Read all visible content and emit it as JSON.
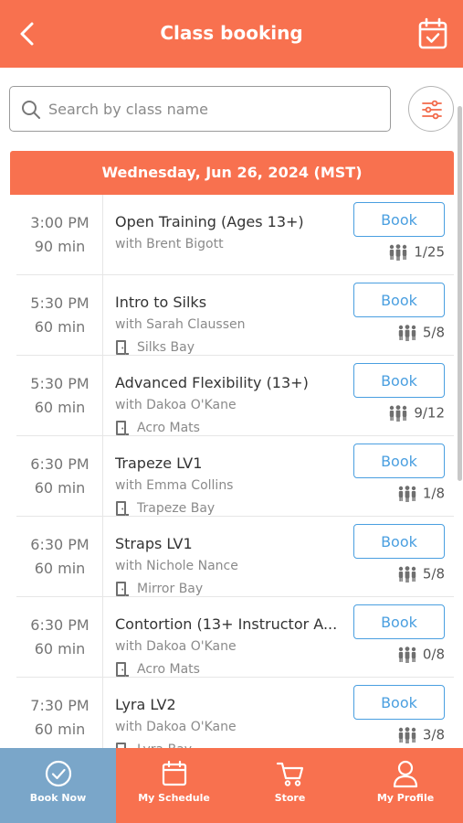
{
  "header": {
    "title": "Class booking",
    "back_icon": "chevron-left-icon",
    "calendar_icon": "calendar-check-icon"
  },
  "search": {
    "placeholder": "Search by class name",
    "icon": "search-icon",
    "filter_icon": "sliders-icon"
  },
  "date_header": "Wednesday, Jun 26, 2024 (MST)",
  "classes": [
    {
      "time": "3:00  PM",
      "duration": "90 min",
      "name": "Open Training (Ages 13+)",
      "instructor": "with Brent Bigott",
      "location": "",
      "book_label": "Book",
      "capacity": "1/25"
    },
    {
      "time": "5:30  PM",
      "duration": "60 min",
      "name": "Intro to Silks",
      "instructor": "with Sarah Claussen",
      "location": "Silks Bay",
      "book_label": "Book",
      "capacity": "5/8"
    },
    {
      "time": "5:30  PM",
      "duration": "60 min",
      "name": "Advanced Flexibility (13+)",
      "instructor": "with Dakoa O'Kane",
      "location": "Acro Mats",
      "book_label": "Book",
      "capacity": "9/12"
    },
    {
      "time": "6:30  PM",
      "duration": "60 min",
      "name": "Trapeze LV1",
      "instructor": "with Emma Collins",
      "location": "Trapeze Bay",
      "book_label": "Book",
      "capacity": "1/8"
    },
    {
      "time": "6:30  PM",
      "duration": "60 min",
      "name": "Straps LV1",
      "instructor": "with Nichole Nance",
      "location": "Mirror Bay",
      "book_label": "Book",
      "capacity": "5/8"
    },
    {
      "time": "6:30  PM",
      "duration": "60 min",
      "name": "Contortion (13+ Instructor A...",
      "instructor": "with Dakoa O'Kane",
      "location": "Acro Mats",
      "book_label": "Book",
      "capacity": "0/8"
    },
    {
      "time": "7:30  PM",
      "duration": "60 min",
      "name": "Lyra LV2",
      "instructor": "with Dakoa O'Kane",
      "location": "Lyra Bay",
      "book_label": "Book",
      "capacity": "3/8"
    }
  ],
  "tabs": [
    {
      "label": "Book Now",
      "icon": "check-circle-icon",
      "active": true
    },
    {
      "label": "My Schedule",
      "icon": "calendar-icon",
      "active": false
    },
    {
      "label": "Store",
      "icon": "cart-icon",
      "active": false
    },
    {
      "label": "My Profile",
      "icon": "user-icon",
      "active": false
    }
  ],
  "colors": {
    "brand": "#f8714f",
    "active_tab": "#7aa6c9",
    "book_button": "#4a9fe0"
  }
}
